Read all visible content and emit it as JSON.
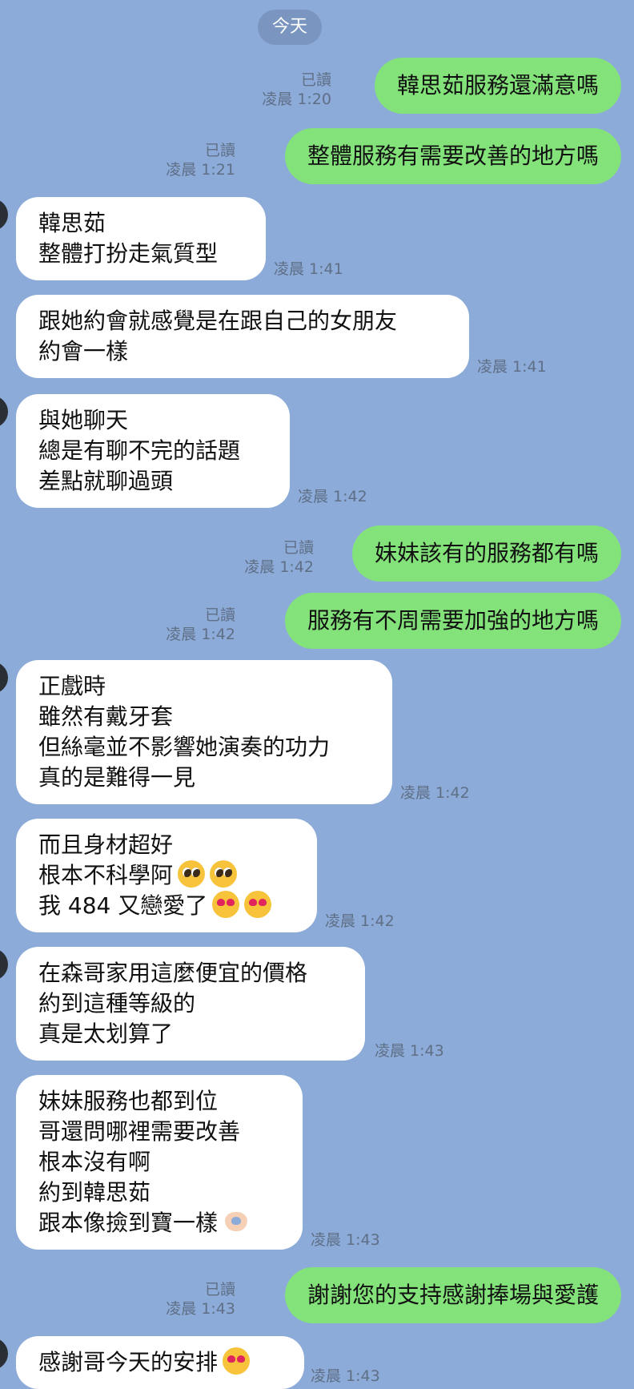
{
  "date_label": "今天",
  "messages": [
    {
      "dir": "out",
      "text": "韓思茹服務還滿意嗎",
      "read": "已讀",
      "time": "凌晨 1:20"
    },
    {
      "dir": "out",
      "text": "整體服務有需要改善的地方嗎",
      "read": "已讀",
      "time": "凌晨 1:21"
    },
    {
      "dir": "in",
      "text": "韓思茹\n整體打扮走氣質型",
      "time": "凌晨 1:41"
    },
    {
      "dir": "in",
      "text": "跟她約會就感覺是在跟自己的女朋友\n約會一樣",
      "time": "凌晨 1:41"
    },
    {
      "dir": "in",
      "text": "與她聊天\n總是有聊不完的話題\n差點就聊過頭",
      "time": "凌晨 1:42"
    },
    {
      "dir": "out",
      "text": "妹妹該有的服務都有嗎",
      "read": "已讀",
      "time": "凌晨 1:42"
    },
    {
      "dir": "out",
      "text": "服務有不周需要加強的地方嗎",
      "read": "已讀",
      "time": "凌晨 1:42"
    },
    {
      "dir": "in",
      "text": "正戲時\n雖然有戴牙套\n但絲毫並不影響她演奏的功力\n真的是難得一見",
      "time": "凌晨 1:42"
    },
    {
      "dir": "in",
      "lines": [
        "而且身材超好",
        "根本不科學阿",
        "我 484 又戀愛了"
      ],
      "emoji_line1": "pleading-face-emoji",
      "emoji_line2": "heart-eyes-emoji",
      "time": "凌晨 1:42"
    },
    {
      "dir": "in",
      "text": "在森哥家用這麼便宜的價格\n約到這種等級的\n真是太划算了",
      "time": "凌晨 1:43"
    },
    {
      "dir": "in",
      "lines": [
        "妹妹服務也都到位",
        "哥還問哪裡需要改善",
        "根本沒有啊",
        "約到韓思茹",
        "跟本像撿到寶一樣"
      ],
      "emoji_last": "heart-hands-emoji",
      "time": "凌晨 1:43"
    },
    {
      "dir": "out",
      "text": "謝謝您的支持感謝捧場與愛護",
      "read": "已讀",
      "time": "凌晨 1:43"
    },
    {
      "dir": "in",
      "lines": [
        "感謝哥今天的安排"
      ],
      "emoji_last": "heart-eyes-emoji",
      "time": "凌晨 1:43"
    }
  ]
}
